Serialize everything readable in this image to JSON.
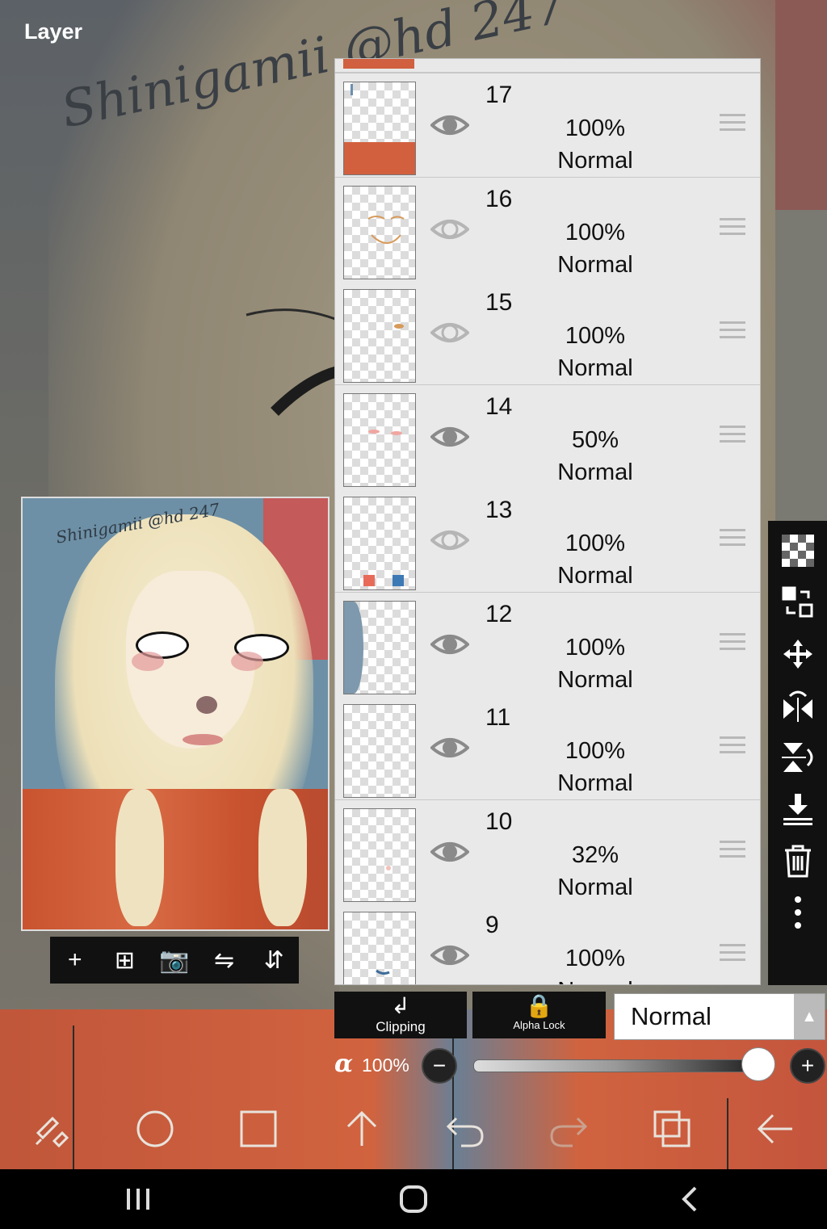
{
  "panel": {
    "title": "Layer"
  },
  "artwork": {
    "signature": "Shinigamii @hd 247"
  },
  "preview_toolbar": {
    "add_icon": "+",
    "add_layer_icon": "⊞",
    "camera_icon": "📷",
    "flip_h_icon": "⇋",
    "flip_v_icon": "⇵"
  },
  "layers": [
    {
      "number": "17",
      "opacity": "100%",
      "mode": "Normal",
      "visible": "eye-on"
    },
    {
      "number": "16",
      "opacity": "100%",
      "mode": "Normal",
      "visible": "eye-off"
    },
    {
      "number": "15",
      "opacity": "100%",
      "mode": "Normal",
      "visible": "eye-off"
    },
    {
      "number": "14",
      "opacity": "50%",
      "mode": "Normal",
      "visible": "eye-on"
    },
    {
      "number": "13",
      "opacity": "100%",
      "mode": "Normal",
      "visible": "eye-off"
    },
    {
      "number": "12",
      "opacity": "100%",
      "mode": "Normal",
      "visible": "eye-on"
    },
    {
      "number": "11",
      "opacity": "100%",
      "mode": "Normal",
      "visible": "eye-on"
    },
    {
      "number": "10",
      "opacity": "32%",
      "mode": "Normal",
      "visible": "eye-on"
    },
    {
      "number": "9",
      "opacity": "100%",
      "mode": "Normal",
      "visible": "eye-on"
    }
  ],
  "layer_controls": {
    "clipping_label": "Clipping",
    "alpha_lock_label": "Alpha Lock",
    "blend_mode": "Normal",
    "opacity_symbol": "α",
    "opacity_value": "100%",
    "opacity_level": 1.0,
    "minus": "−",
    "plus": "+"
  },
  "colors": {
    "panel_bg": "#e8e8e8",
    "toolbar_bg": "#111111",
    "shirt_orange": "#d0633f"
  }
}
